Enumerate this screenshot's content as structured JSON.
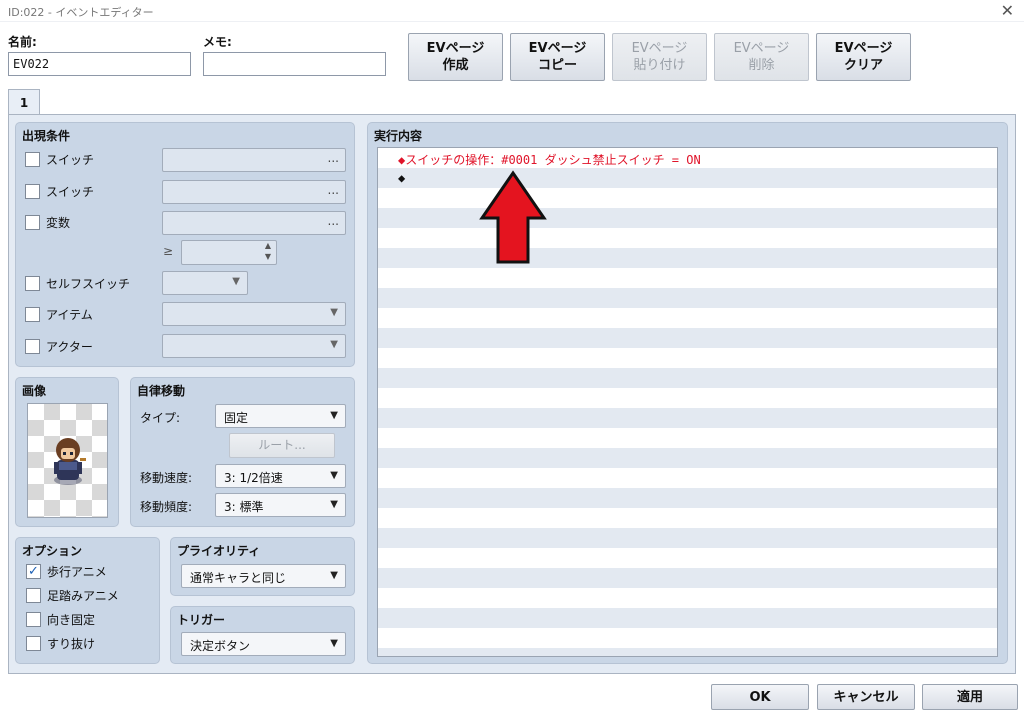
{
  "window": {
    "title": "ID:022 - イベントエディター",
    "close_glyph": "✕"
  },
  "header": {
    "name_label": "名前:",
    "name_value": "EV022",
    "memo_label": "メモ:",
    "memo_value": ""
  },
  "page_buttons": [
    {
      "line1": "EVページ",
      "line2": "作成",
      "enabled": true
    },
    {
      "line1": "EVページ",
      "line2": "コピー",
      "enabled": true
    },
    {
      "line1": "EVページ",
      "line2": "貼り付け",
      "enabled": false
    },
    {
      "line1": "EVページ",
      "line2": "削除",
      "enabled": false
    },
    {
      "line1": "EVページ",
      "line2": "クリア",
      "enabled": true
    }
  ],
  "tabs": [
    "1"
  ],
  "conditions": {
    "title": "出現条件",
    "switch1": "スイッチ",
    "switch2": "スイッチ",
    "variable": "変数",
    "ge_symbol": "≥",
    "self_switch": "セルフスイッチ",
    "item": "アイテム",
    "actor": "アクター",
    "dots": "..."
  },
  "image": {
    "title": "画像"
  },
  "autonomous": {
    "title": "自律移動",
    "type_label": "タイプ:",
    "type_value": "固定",
    "route_button": "ルート...",
    "speed_label": "移動速度:",
    "speed_value": "3: 1/2倍速",
    "freq_label": "移動頻度:",
    "freq_value": "3: 標準"
  },
  "options": {
    "title": "オプション",
    "walking": {
      "label": "歩行アニメ",
      "checked": true
    },
    "stepping": {
      "label": "足踏みアニメ",
      "checked": false
    },
    "direction_fix": {
      "label": "向き固定",
      "checked": false
    },
    "through": {
      "label": "すり抜け",
      "checked": false
    }
  },
  "priority": {
    "title": "プライオリティ",
    "value": "通常キャラと同じ"
  },
  "trigger": {
    "title": "トリガー",
    "value": "決定ボタン"
  },
  "contents": {
    "title": "実行内容",
    "lines": [
      {
        "text": "◆スイッチの操作：#0001 ダッシュ禁止スイッチ = ON",
        "color": "#e0142a"
      },
      {
        "text": "◆",
        "color": "#111111"
      }
    ]
  },
  "annotation_arrow": {
    "color": "#e4141f",
    "icon": "red-up-arrow"
  },
  "footer": {
    "ok": "OK",
    "cancel": "キャンセル",
    "apply": "適用"
  },
  "checkmark": "✓",
  "dropdown_arrow": "▼",
  "spin_up": "▲",
  "spin_down": "▼"
}
